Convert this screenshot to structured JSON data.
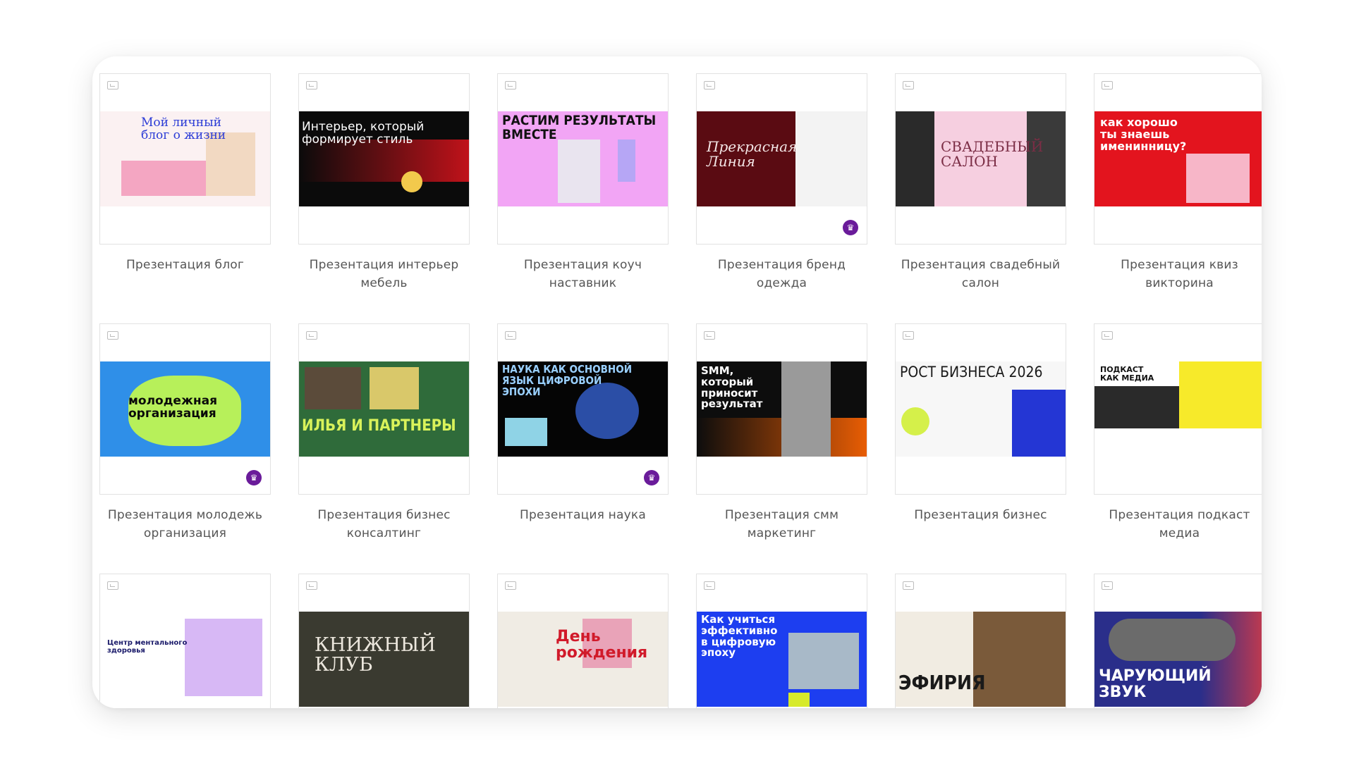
{
  "cards": [
    {
      "caption": "Презентация блог",
      "slide_text": "Мой личный\nблог о жизни",
      "premium": false
    },
    {
      "caption": "Презентация интерьер мебель",
      "slide_text": "Интерьер, который\nформирует стиль",
      "premium": false
    },
    {
      "caption": "Презентация коуч наставник",
      "slide_text": "РАСТИМ РЕЗУЛЬТАТЫ\nВМЕСТЕ",
      "premium": false
    },
    {
      "caption": "Презентация бренд одежда",
      "slide_text": "Прекрасная\nЛиния",
      "premium": true
    },
    {
      "caption": "Презентация свадебный салон",
      "slide_text": "СВАДЕБНЫЙ\nСАЛОН",
      "premium": false
    },
    {
      "caption": "Презентация квиз викторина",
      "slide_text": "как хорошо\nты знаешь\nименинницу?",
      "premium": false
    },
    {
      "caption": "Презентация молодежь организация",
      "slide_text": "молодежная\nорганизация",
      "premium": true
    },
    {
      "caption": "Презентация бизнес консалтинг",
      "slide_text": "ИЛЬЯ И ПАРТНЕРЫ",
      "premium": false
    },
    {
      "caption": "Презентация наука",
      "slide_text": "НАУКА КАК ОСНОВНОЙ\nЯЗЫК ЦИФРОВОЙ\nЭПОХИ",
      "premium": true
    },
    {
      "caption": "Презентация смм маркетинг",
      "slide_text": "SMM,\nкоторый\nприносит\nрезультат",
      "premium": false
    },
    {
      "caption": "Презентация бизнес",
      "slide_text": "РОСТ БИЗНЕСА 2026",
      "premium": false
    },
    {
      "caption": "Презентация подкаст медиа",
      "slide_text": "ПОДКАСТ\nКАК МЕДИА",
      "premium": false
    },
    {
      "caption": "",
      "slide_text": "Центр ментального\nздоровья",
      "premium": false
    },
    {
      "caption": "",
      "slide_text": "КНИЖНЫЙ\nКЛУБ",
      "premium": false
    },
    {
      "caption": "",
      "slide_text": "День\nрождения",
      "premium": false
    },
    {
      "caption": "",
      "slide_text": "Как учиться\nэффективно\nв цифровую\nэпоху",
      "premium": false
    },
    {
      "caption": "",
      "slide_text": "ЭФИРИЯ",
      "premium": false
    },
    {
      "caption": "",
      "slide_text": "ЧАРУЮЩИЙ\nЗВУК",
      "premium": false
    }
  ],
  "premium_icon": "trophy-icon",
  "image_icon": "image-placeholder-icon"
}
